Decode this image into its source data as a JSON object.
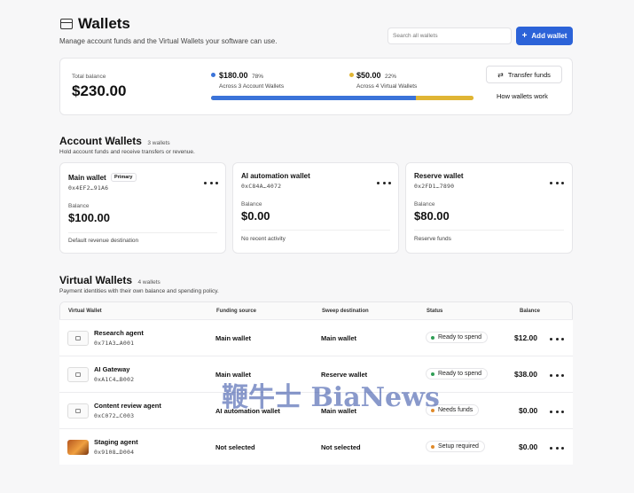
{
  "header": {
    "title": "Wallets",
    "subtitle": "Manage account funds and the Virtual Wallets your software can use.",
    "search_placeholder": "Search all wallets",
    "add_button_label": "Add wallet"
  },
  "summary": {
    "total_label": "Total balance",
    "total_value": "$230.00",
    "account": {
      "amount": "$180.00",
      "percent": "78%",
      "caption": "Across 3 Account Wallets",
      "color": "#3b73d9",
      "share": 0.78
    },
    "virtual": {
      "amount": "$50.00",
      "percent": "22%",
      "caption": "Across 4 Virtual Wallets",
      "color": "#e0b534",
      "share": 0.22
    },
    "transfer_button_label": "Transfer funds",
    "how_link_label": "How wallets work"
  },
  "account_section": {
    "title": "Account Wallets",
    "count": "3 wallets",
    "description": "Hold account funds and receive transfers or revenue.",
    "cards": [
      {
        "name": "Main wallet",
        "badge": "Primary",
        "address": "0x4EF2…91A6",
        "balance_label": "Balance",
        "balance": "$100.00",
        "footer": "Default revenue destination"
      },
      {
        "name": "AI automation wallet",
        "badge": "",
        "address": "0xC84A…4072",
        "balance_label": "Balance",
        "balance": "$0.00",
        "footer": "No recent activity"
      },
      {
        "name": "Reserve wallet",
        "badge": "",
        "address": "0x2FD1…7890",
        "balance_label": "Balance",
        "balance": "$80.00",
        "footer": "Reserve funds"
      }
    ]
  },
  "virtual_section": {
    "title": "Virtual Wallets",
    "count": "4 wallets",
    "description": "Payment identities with their own balance and spending policy.",
    "columns": [
      "Virtual Wallet",
      "Funding source",
      "Sweep destination",
      "Status",
      "Balance"
    ],
    "rows": [
      {
        "name": "Research agent",
        "address": "0x71A3…A001",
        "funding": "Main wallet",
        "sweep": "Main wallet",
        "status": "Ready to spend",
        "status_color": "#2f9e55",
        "balance": "$12.00",
        "thumb": "plain"
      },
      {
        "name": "AI Gateway",
        "address": "0xA1C4…B002",
        "funding": "Main wallet",
        "sweep": "Reserve wallet",
        "status": "Ready to spend",
        "status_color": "#2f9e55",
        "balance": "$38.00",
        "thumb": "plain"
      },
      {
        "name": "Content review agent",
        "address": "0xC072…C003",
        "funding": "AI automation wallet",
        "sweep": "Main wallet",
        "status": "Needs funds",
        "status_color": "#e08a2a",
        "balance": "$0.00",
        "thumb": "plain"
      },
      {
        "name": "Staging agent",
        "address": "0x9108…D004",
        "funding": "Not selected",
        "sweep": "Not selected",
        "status": "Setup required",
        "status_color": "#e08a2a",
        "balance": "$0.00",
        "thumb": "orange"
      }
    ]
  },
  "watermark": "鞭牛士 BiaNews"
}
